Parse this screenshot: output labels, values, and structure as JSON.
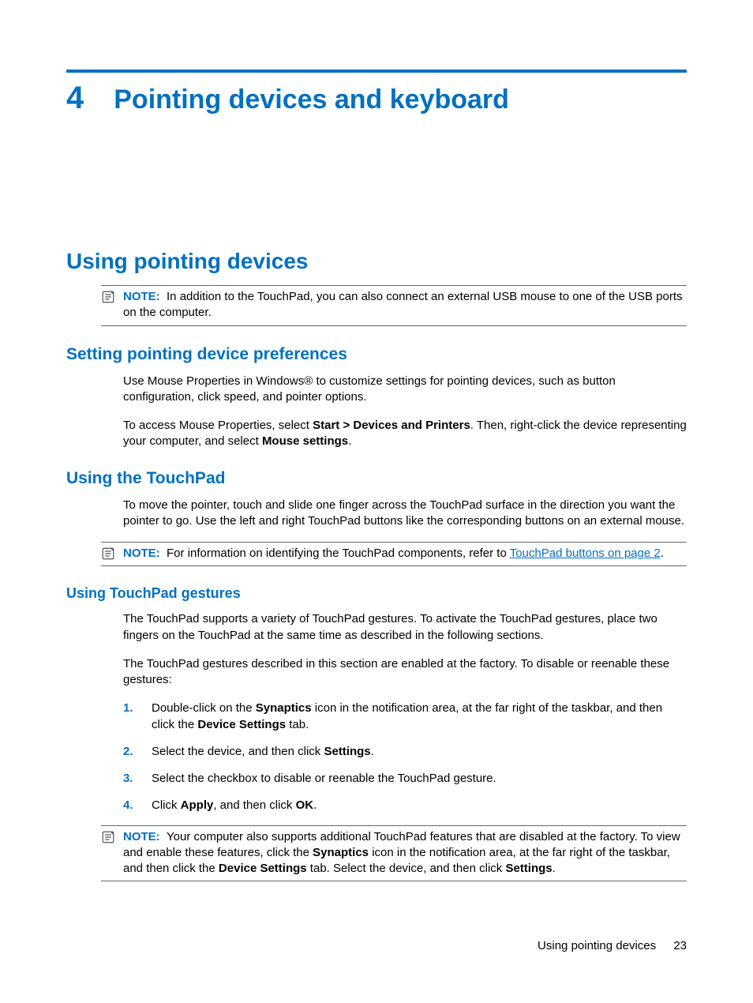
{
  "chapter": {
    "number": "4",
    "title": "Pointing devices and keyboard"
  },
  "section": {
    "title": "Using pointing devices"
  },
  "note1": {
    "label": "NOTE:",
    "text": "In addition to the TouchPad, you can also connect an external USB mouse to one of the USB ports on the computer."
  },
  "subA": {
    "title": "Setting pointing device preferences",
    "p1": "Use Mouse Properties in Windows® to customize settings for pointing devices, such as button configuration, click speed, and pointer options.",
    "p2_pre": "To access Mouse Properties, select ",
    "p2_b1": "Start > Devices and Printers",
    "p2_mid": ". Then, right-click the device representing your computer, and select ",
    "p2_b2": "Mouse settings",
    "p2_post": "."
  },
  "subB": {
    "title": "Using the TouchPad",
    "p1": "To move the pointer, touch and slide one finger across the TouchPad surface in the direction you want the pointer to go. Use the left and right TouchPad buttons like the corresponding buttons on an external mouse."
  },
  "note2": {
    "label": "NOTE:",
    "pre": "For information on identifying the TouchPad components, refer to ",
    "link": "TouchPad buttons on page 2",
    "post": "."
  },
  "subC": {
    "title": "Using TouchPad gestures",
    "p1": "The TouchPad supports a variety of TouchPad gestures. To activate the TouchPad gestures, place two fingers on the TouchPad at the same time as described in the following sections.",
    "p2": "The TouchPad gestures described in this section are enabled at the factory. To disable or reenable these gestures:",
    "steps": {
      "s1_pre": "Double-click on the ",
      "s1_b1": "Synaptics",
      "s1_mid": " icon in the notification area, at the far right of the taskbar, and then click the ",
      "s1_b2": "Device Settings",
      "s1_post": " tab.",
      "s2_pre": "Select the device, and then click ",
      "s2_b1": "Settings",
      "s2_post": ".",
      "s3": "Select the checkbox to disable or reenable the TouchPad gesture.",
      "s4_pre": "Click ",
      "s4_b1": "Apply",
      "s4_mid": ", and then click ",
      "s4_b2": "OK",
      "s4_post": "."
    }
  },
  "note3": {
    "label": "NOTE:",
    "pre": "Your computer also supports additional TouchPad features that are disabled at the factory. To view and enable these features, click the ",
    "b1": "Synaptics",
    "mid1": " icon in the notification area, at the far right of the taskbar, and then click the ",
    "b2": "Device Settings",
    "mid2": " tab. Select the device, and then click ",
    "b3": "Settings",
    "post": "."
  },
  "footer": {
    "text": "Using pointing devices",
    "page": "23"
  }
}
